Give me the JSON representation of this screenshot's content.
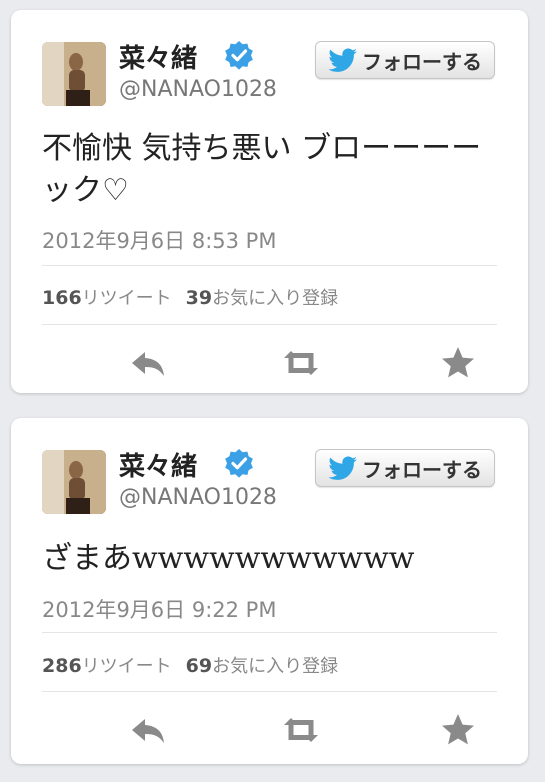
{
  "tweets": [
    {
      "user": {
        "name": "菜々緒",
        "handle": "@NANAO1028",
        "verified": true
      },
      "follow_label": "フォローする",
      "text": "不愉快 気持ち悪い ブローーーーック♡",
      "timestamp": "2012年9月6日 8:53 PM",
      "retweets_count": "166",
      "retweets_label": "リツイート",
      "favorites_count": "39",
      "favorites_label": "お気に入り登録"
    },
    {
      "user": {
        "name": "菜々緒",
        "handle": "@NANAO1028",
        "verified": true
      },
      "follow_label": "フォローする",
      "text": "ざまあwwwwwwwwwww",
      "timestamp": "2012年9月6日 9:22 PM",
      "retweets_count": "286",
      "retweets_label": "リツイート",
      "favorites_count": "69",
      "favorites_label": "お気に入り登録"
    }
  ],
  "icons": {
    "follow": "twitter-bird-icon",
    "verified": "verified-badge-icon",
    "reply": "reply-icon",
    "retweet": "retweet-icon",
    "favorite": "star-icon"
  },
  "colors": {
    "twitter_blue": "#2fa7e6",
    "verified_blue": "#3ba0e6",
    "icon_gray": "#8a8a8a"
  }
}
